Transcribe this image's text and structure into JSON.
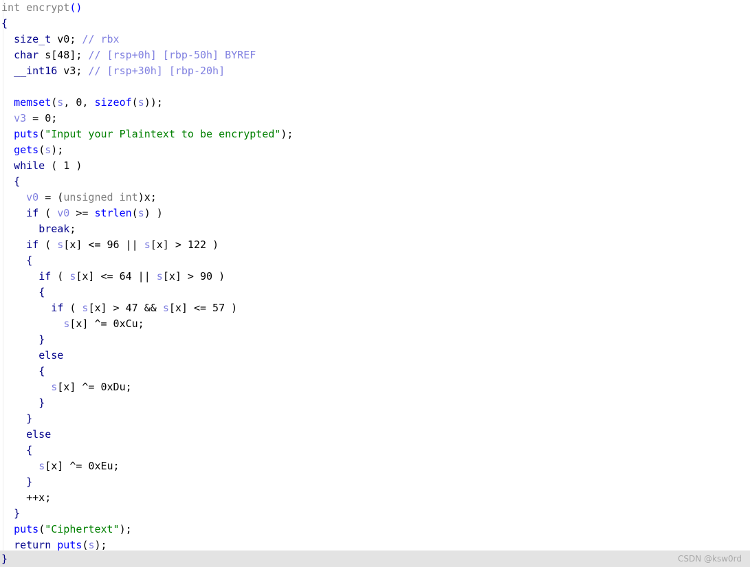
{
  "window": {
    "title": "int encrypt()",
    "background_color": "#ffffff",
    "footer_color": "#e3e3e3"
  },
  "palette": {
    "keyword": "#00008b",
    "function": "#0000ff",
    "string": "#008000",
    "variable": "#8080e0",
    "comment": "#8080e0",
    "type": "#808080",
    "punctuation": "#000000",
    "brace": "#000080",
    "watermark": "#a9a9a9"
  },
  "code": {
    "language": "c-pseudocode",
    "lines": [
      {
        "n": 1,
        "indent": 0,
        "tokens": [
          {
            "t": "typ",
            "v": "int "
          },
          {
            "t": "typ",
            "v": "encrypt"
          },
          {
            "t": "fn",
            "v": "()"
          }
        ]
      },
      {
        "n": 2,
        "indent": 0,
        "tokens": [
          {
            "t": "brc",
            "v": "{"
          }
        ]
      },
      {
        "n": 3,
        "indent": 1,
        "tokens": [
          {
            "t": "kw",
            "v": "size_t"
          },
          {
            "t": "pun",
            "v": " v0; "
          },
          {
            "t": "cmt",
            "v": "// rbx"
          }
        ]
      },
      {
        "n": 4,
        "indent": 1,
        "tokens": [
          {
            "t": "kw",
            "v": "char"
          },
          {
            "t": "pun",
            "v": " s[48]; "
          },
          {
            "t": "cmt",
            "v": "// [rsp+0h] [rbp-50h] BYREF"
          }
        ]
      },
      {
        "n": 5,
        "indent": 1,
        "tokens": [
          {
            "t": "kw",
            "v": "__int16"
          },
          {
            "t": "pun",
            "v": " v3; "
          },
          {
            "t": "cmt",
            "v": "// [rsp+30h] [rbp-20h]"
          }
        ]
      },
      {
        "n": 6,
        "indent": 0,
        "tokens": []
      },
      {
        "n": 7,
        "indent": 1,
        "tokens": [
          {
            "t": "fn",
            "v": "memset"
          },
          {
            "t": "pun",
            "v": "("
          },
          {
            "t": "var",
            "v": "s"
          },
          {
            "t": "pun",
            "v": ", 0, "
          },
          {
            "t": "fn",
            "v": "sizeof"
          },
          {
            "t": "pun",
            "v": "("
          },
          {
            "t": "var",
            "v": "s"
          },
          {
            "t": "pun",
            "v": "));"
          }
        ]
      },
      {
        "n": 8,
        "indent": 1,
        "tokens": [
          {
            "t": "var",
            "v": "v3"
          },
          {
            "t": "pun",
            "v": " = 0;"
          }
        ]
      },
      {
        "n": 9,
        "indent": 1,
        "tokens": [
          {
            "t": "fn",
            "v": "puts"
          },
          {
            "t": "pun",
            "v": "("
          },
          {
            "t": "str",
            "v": "\"Input your Plaintext to be encrypted\""
          },
          {
            "t": "pun",
            "v": ");"
          }
        ]
      },
      {
        "n": 10,
        "indent": 1,
        "tokens": [
          {
            "t": "fn",
            "v": "gets"
          },
          {
            "t": "pun",
            "v": "("
          },
          {
            "t": "var",
            "v": "s"
          },
          {
            "t": "pun",
            "v": ");"
          }
        ]
      },
      {
        "n": 11,
        "indent": 1,
        "tokens": [
          {
            "t": "kw",
            "v": "while"
          },
          {
            "t": "pun",
            "v": " ( 1 )"
          }
        ]
      },
      {
        "n": 12,
        "indent": 1,
        "tokens": [
          {
            "t": "brc",
            "v": "{"
          }
        ]
      },
      {
        "n": 13,
        "indent": 2,
        "tokens": [
          {
            "t": "var",
            "v": "v0"
          },
          {
            "t": "pun",
            "v": " = ("
          },
          {
            "t": "typ",
            "v": "unsigned int"
          },
          {
            "t": "pun",
            "v": ")x;"
          }
        ]
      },
      {
        "n": 14,
        "indent": 2,
        "tokens": [
          {
            "t": "kw",
            "v": "if"
          },
          {
            "t": "pun",
            "v": " ( "
          },
          {
            "t": "var",
            "v": "v0"
          },
          {
            "t": "pun",
            "v": " >= "
          },
          {
            "t": "fn",
            "v": "strlen"
          },
          {
            "t": "pun",
            "v": "("
          },
          {
            "t": "var",
            "v": "s"
          },
          {
            "t": "pun",
            "v": ") )"
          }
        ]
      },
      {
        "n": 15,
        "indent": 3,
        "tokens": [
          {
            "t": "kw",
            "v": "break"
          },
          {
            "t": "pun",
            "v": ";"
          }
        ]
      },
      {
        "n": 16,
        "indent": 2,
        "tokens": [
          {
            "t": "kw",
            "v": "if"
          },
          {
            "t": "pun",
            "v": " ( "
          },
          {
            "t": "var",
            "v": "s"
          },
          {
            "t": "pun",
            "v": "[x] <= 96 || "
          },
          {
            "t": "var",
            "v": "s"
          },
          {
            "t": "pun",
            "v": "[x] > 122 )"
          }
        ]
      },
      {
        "n": 17,
        "indent": 2,
        "tokens": [
          {
            "t": "brc",
            "v": "{"
          }
        ]
      },
      {
        "n": 18,
        "indent": 3,
        "tokens": [
          {
            "t": "kw",
            "v": "if"
          },
          {
            "t": "pun",
            "v": " ( "
          },
          {
            "t": "var",
            "v": "s"
          },
          {
            "t": "pun",
            "v": "[x] <= 64 || "
          },
          {
            "t": "var",
            "v": "s"
          },
          {
            "t": "pun",
            "v": "[x] > 90 )"
          }
        ]
      },
      {
        "n": 19,
        "indent": 3,
        "tokens": [
          {
            "t": "brc",
            "v": "{"
          }
        ]
      },
      {
        "n": 20,
        "indent": 4,
        "tokens": [
          {
            "t": "kw",
            "v": "if"
          },
          {
            "t": "pun",
            "v": " ( "
          },
          {
            "t": "var",
            "v": "s"
          },
          {
            "t": "pun",
            "v": "[x] > 47 && "
          },
          {
            "t": "var",
            "v": "s"
          },
          {
            "t": "pun",
            "v": "[x] <= 57 )"
          }
        ]
      },
      {
        "n": 21,
        "indent": 5,
        "tokens": [
          {
            "t": "var",
            "v": "s"
          },
          {
            "t": "pun",
            "v": "[x] ^= 0xCu;"
          }
        ]
      },
      {
        "n": 22,
        "indent": 3,
        "tokens": [
          {
            "t": "brc",
            "v": "}"
          }
        ]
      },
      {
        "n": 23,
        "indent": 3,
        "tokens": [
          {
            "t": "kw",
            "v": "else"
          }
        ]
      },
      {
        "n": 24,
        "indent": 3,
        "tokens": [
          {
            "t": "brc",
            "v": "{"
          }
        ]
      },
      {
        "n": 25,
        "indent": 4,
        "tokens": [
          {
            "t": "var",
            "v": "s"
          },
          {
            "t": "pun",
            "v": "[x] ^= 0xDu;"
          }
        ]
      },
      {
        "n": 26,
        "indent": 3,
        "tokens": [
          {
            "t": "brc",
            "v": "}"
          }
        ]
      },
      {
        "n": 27,
        "indent": 2,
        "tokens": [
          {
            "t": "brc",
            "v": "}"
          }
        ]
      },
      {
        "n": 28,
        "indent": 2,
        "tokens": [
          {
            "t": "kw",
            "v": "else"
          }
        ]
      },
      {
        "n": 29,
        "indent": 2,
        "tokens": [
          {
            "t": "brc",
            "v": "{"
          }
        ]
      },
      {
        "n": 30,
        "indent": 3,
        "tokens": [
          {
            "t": "var",
            "v": "s"
          },
          {
            "t": "pun",
            "v": "[x] ^= 0xEu;"
          }
        ]
      },
      {
        "n": 31,
        "indent": 2,
        "tokens": [
          {
            "t": "brc",
            "v": "}"
          }
        ]
      },
      {
        "n": 32,
        "indent": 2,
        "tokens": [
          {
            "t": "pun",
            "v": "++x;"
          }
        ]
      },
      {
        "n": 33,
        "indent": 1,
        "tokens": [
          {
            "t": "brc",
            "v": "}"
          }
        ]
      },
      {
        "n": 34,
        "indent": 1,
        "tokens": [
          {
            "t": "fn",
            "v": "puts"
          },
          {
            "t": "pun",
            "v": "("
          },
          {
            "t": "str",
            "v": "\"Ciphertext\""
          },
          {
            "t": "pun",
            "v": ");"
          }
        ]
      },
      {
        "n": 35,
        "indent": 1,
        "tokens": [
          {
            "t": "kw",
            "v": "return"
          },
          {
            "t": "pun",
            "v": " "
          },
          {
            "t": "fn",
            "v": "puts"
          },
          {
            "t": "pun",
            "v": "("
          },
          {
            "t": "var",
            "v": "s"
          },
          {
            "t": "pun",
            "v": ");"
          }
        ]
      }
    ]
  },
  "footer": {
    "closing_brace": "}",
    "watermark": "CSDN @ksw0rd"
  }
}
